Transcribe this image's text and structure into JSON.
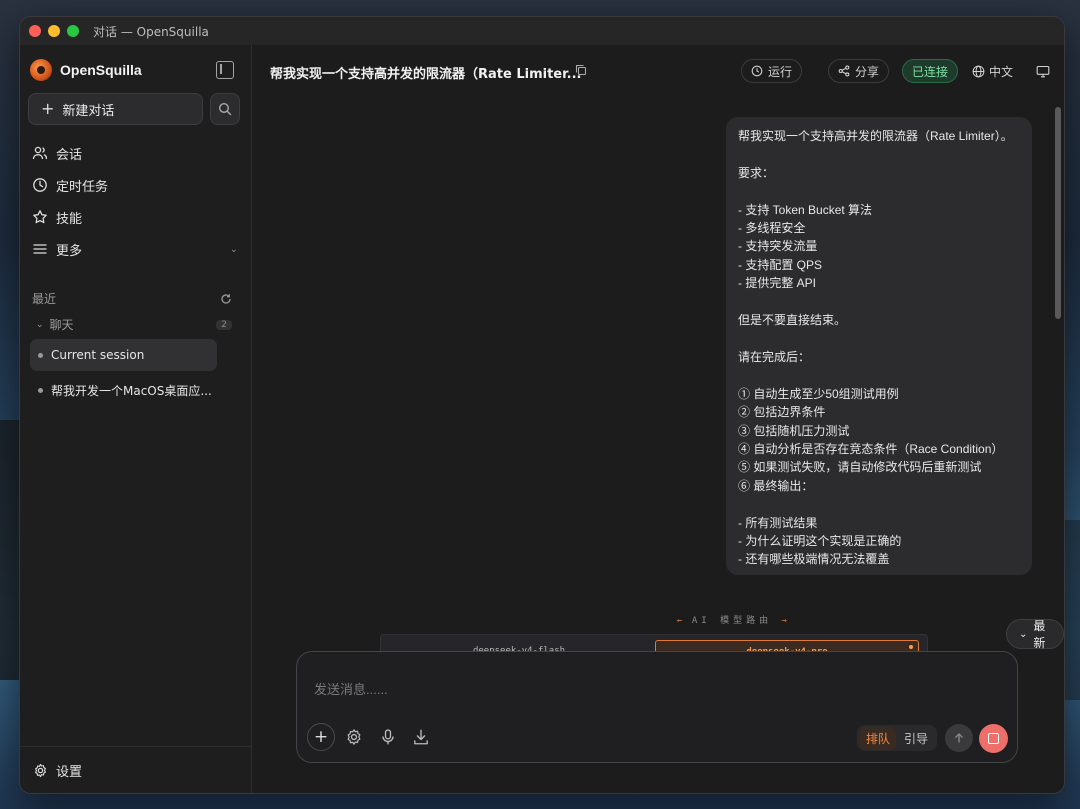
{
  "window": {
    "title": "对话 — OpenSquilla"
  },
  "sidebar": {
    "brand": "OpenSquilla",
    "new_chat": "新建对话",
    "nav": [
      {
        "label": "会话",
        "icon": "users-icon"
      },
      {
        "label": "定时任务",
        "icon": "clock-icon"
      },
      {
        "label": "技能",
        "icon": "star-icon"
      },
      {
        "label": "更多",
        "icon": "menu-icon"
      }
    ],
    "recent_label": "最近",
    "group": {
      "label": "聊天",
      "count": "2"
    },
    "sessions": [
      {
        "label": "Current session",
        "active": true
      },
      {
        "label": "帮我开发一个MacOS桌面应..."
      }
    ],
    "settings": "设置"
  },
  "header": {
    "title": "帮我实现一个支持高并发的限流器（Rate Limiter...",
    "run": "运行",
    "share": "分享",
    "status": "已连接",
    "language": "中文"
  },
  "message": {
    "text": "帮我实现一个支持高并发的限流器（Rate Limiter）。\n\n要求：\n\n- 支持 Token Bucket 算法\n- 多线程安全\n- 支持突发流量\n- 支持配置 QPS\n- 提供完整 API\n\n但是不要直接结束。\n\n请在完成后：\n\n① 自动生成至少50组测试用例\n② 包括边界条件\n③ 包括随机压力测试\n④ 自动分析是否存在竞态条件（Race Condition）\n⑤ 如果测试失败，请自动修改代码后重新测试\n⑥ 最终输出：\n\n- 所有测试结果\n- 为什么证明这个实现是正确的\n- 还有哪些极端情况无法覆盖"
  },
  "router": {
    "label": "AI 模型路由",
    "models": [
      "deepseek-v4-flash",
      "deepseek-v4-pro"
    ]
  },
  "latest_button": "最新",
  "composer": {
    "placeholder": "发送消息......",
    "value": "",
    "mode_queue": "排队",
    "mode_guide": "引导"
  },
  "colors": {
    "accent": "#f08a45",
    "connected": "#7fe0a6",
    "stop": "#ee6f6a"
  }
}
